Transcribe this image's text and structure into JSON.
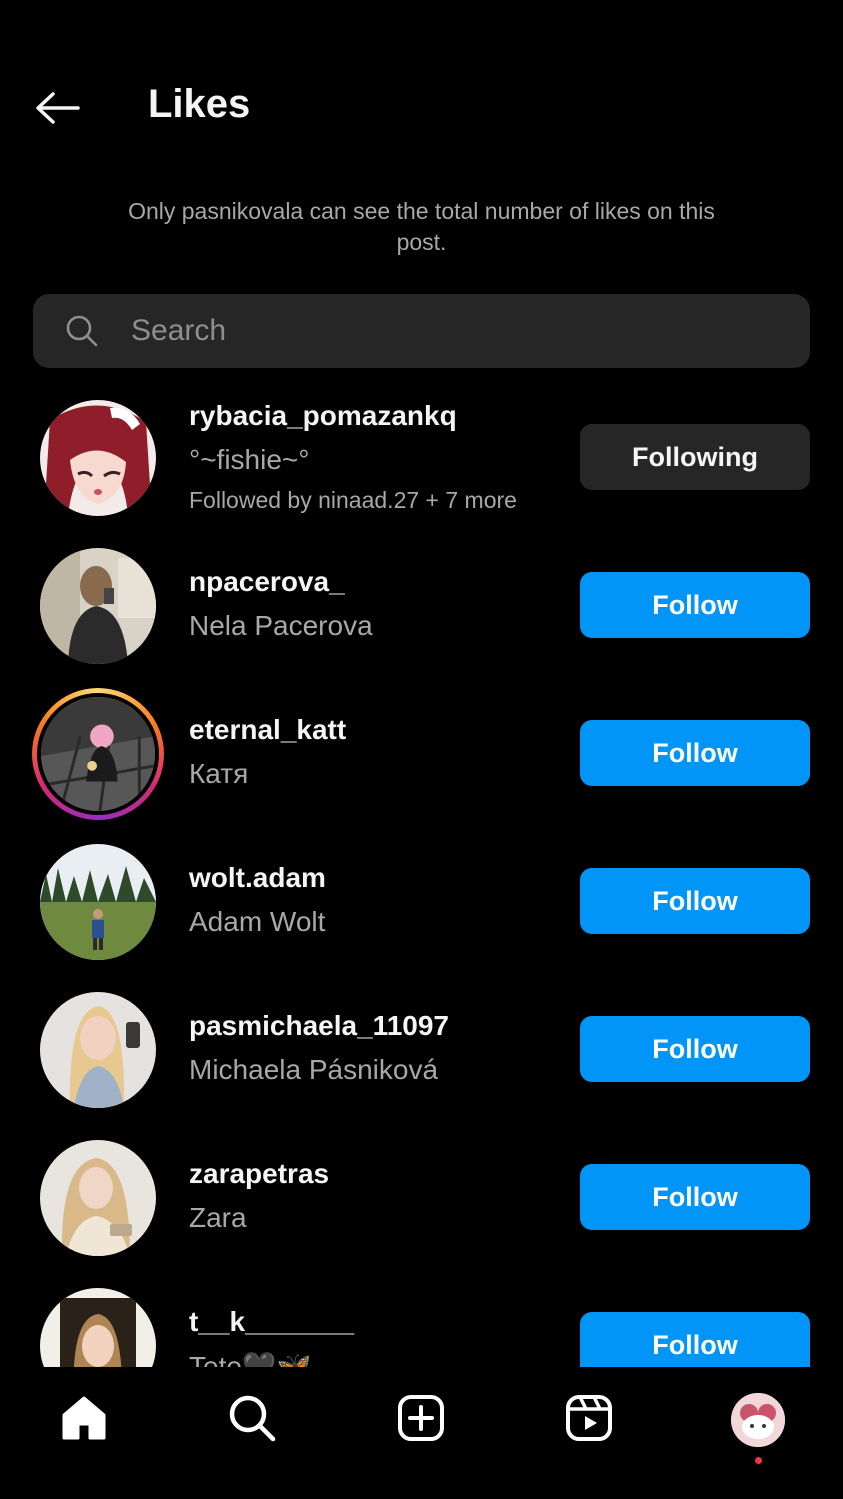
{
  "header": {
    "title": "Likes"
  },
  "notice": "Only pasnikovala can see the total number of likes on this post.",
  "search": {
    "placeholder": "Search"
  },
  "likers": [
    {
      "username": "rybacia_pomazankq",
      "name": "°~fishie~°",
      "mutual": "Followed by ninaad.27 + 7 more",
      "button": "Following"
    },
    {
      "username": "npacerova_",
      "name": "Nela Pacerova",
      "button": "Follow"
    },
    {
      "username": "eternal_katt",
      "name": "Катя",
      "button": "Follow"
    },
    {
      "username": "wolt.adam",
      "name": "Adam Wolt",
      "button": "Follow"
    },
    {
      "username": "pasmichaela_11097",
      "name": "Michaela Pásniková",
      "button": "Follow"
    },
    {
      "username": "zarapetras",
      "name": "Zara",
      "button": "Follow"
    },
    {
      "username": "t__k_______",
      "name": "Tete🖤🦋",
      "button": "Follow"
    }
  ],
  "icons": {
    "back": "arrow-left-icon",
    "search": "search-icon",
    "nav": [
      "home-icon",
      "search-icon",
      "create-post-icon",
      "reels-icon",
      "profile-avatar"
    ]
  },
  "colors": {
    "background": "#000000",
    "follow_button": "#0095f6",
    "following_button": "#262626",
    "secondary_text": "#a8a8a8",
    "notification_dot": "#ff3040"
  }
}
